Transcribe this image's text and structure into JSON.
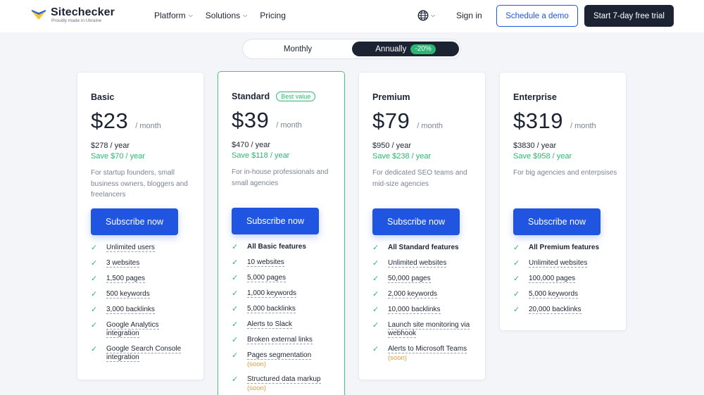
{
  "header": {
    "logo_name": "Sitechecker",
    "logo_sub": "Proudly made in Ukraine",
    "nav": [
      {
        "label": "Platform",
        "dropdown": true
      },
      {
        "label": "Solutions",
        "dropdown": true
      },
      {
        "label": "Pricing",
        "dropdown": false
      }
    ],
    "sign_in": "Sign in",
    "demo_button": "Schedule a demo",
    "trial_button": "Start 7-day free trial"
  },
  "billing": {
    "monthly": "Monthly",
    "annually": "Annually",
    "discount": "-20%",
    "selected": "annually"
  },
  "plans": [
    {
      "name": "Basic",
      "badge": "",
      "price": "$23",
      "per": "/ month",
      "yearly": "$278 / year",
      "save": "Save $70 / year",
      "description": "For startup founders, small business owners, bloggers and freelancers",
      "button": "Subscribe now",
      "features": [
        {
          "text": "Unlimited users"
        },
        {
          "text": "3 websites"
        },
        {
          "text": "1,500 pages"
        },
        {
          "text": "500 keywords"
        },
        {
          "text": "3,000 backlinks"
        },
        {
          "text": "Google Analytics integration"
        },
        {
          "text": "Google Search Console integration"
        }
      ]
    },
    {
      "name": "Standard",
      "badge": "Best value",
      "price": "$39",
      "per": "/ month",
      "yearly": "$470 / year",
      "save": "Save $118 / year",
      "description": "For in-house professionals and small agencies",
      "button": "Subscribe now",
      "features": [
        {
          "text": "All Basic features",
          "bold": true
        },
        {
          "text": "10 websites"
        },
        {
          "text": "5,000 pages"
        },
        {
          "text": "1,000 keywords"
        },
        {
          "text": "5,000 backlinks"
        },
        {
          "text": "Alerts to Slack"
        },
        {
          "text": "Broken external links"
        },
        {
          "text": "Pages segmentation",
          "soon": "(soon)"
        },
        {
          "text": "Structured data markup",
          "soon": "(soon)"
        }
      ]
    },
    {
      "name": "Premium",
      "badge": "",
      "price": "$79",
      "per": "/ month",
      "yearly": "$950 / year",
      "save": "Save $238 / year",
      "description": "For dedicated SEO teams and mid-size agencies",
      "button": "Subscribe now",
      "features": [
        {
          "text": "All Standard features",
          "bold": true
        },
        {
          "text": "Unlimited websites"
        },
        {
          "text": "50,000 pages"
        },
        {
          "text": "2,000 keywords"
        },
        {
          "text": "10,000 backlinks"
        },
        {
          "text": "Launch site monitoring via webhook"
        },
        {
          "text": "Alerts to Microsoft Teams",
          "soon": "(soon)"
        }
      ]
    },
    {
      "name": "Enterprise",
      "badge": "",
      "price": "$319",
      "per": "/ month",
      "yearly": "$3830 / year",
      "save": "Save $958 / year",
      "description": "For big agencies and enterpsises",
      "button": "Subscribe now",
      "features": [
        {
          "text": "All Premium features",
          "bold": true
        },
        {
          "text": "Unlimited websites"
        },
        {
          "text": "100,000 pages"
        },
        {
          "text": "5,000 keywords"
        },
        {
          "text": "20,000 backlinks"
        }
      ]
    }
  ],
  "colors": {
    "brand_dark": "#1c2434",
    "primary_blue": "#1f55e0",
    "accent_green": "#2bb673",
    "soon_orange": "#e59a3a"
  }
}
